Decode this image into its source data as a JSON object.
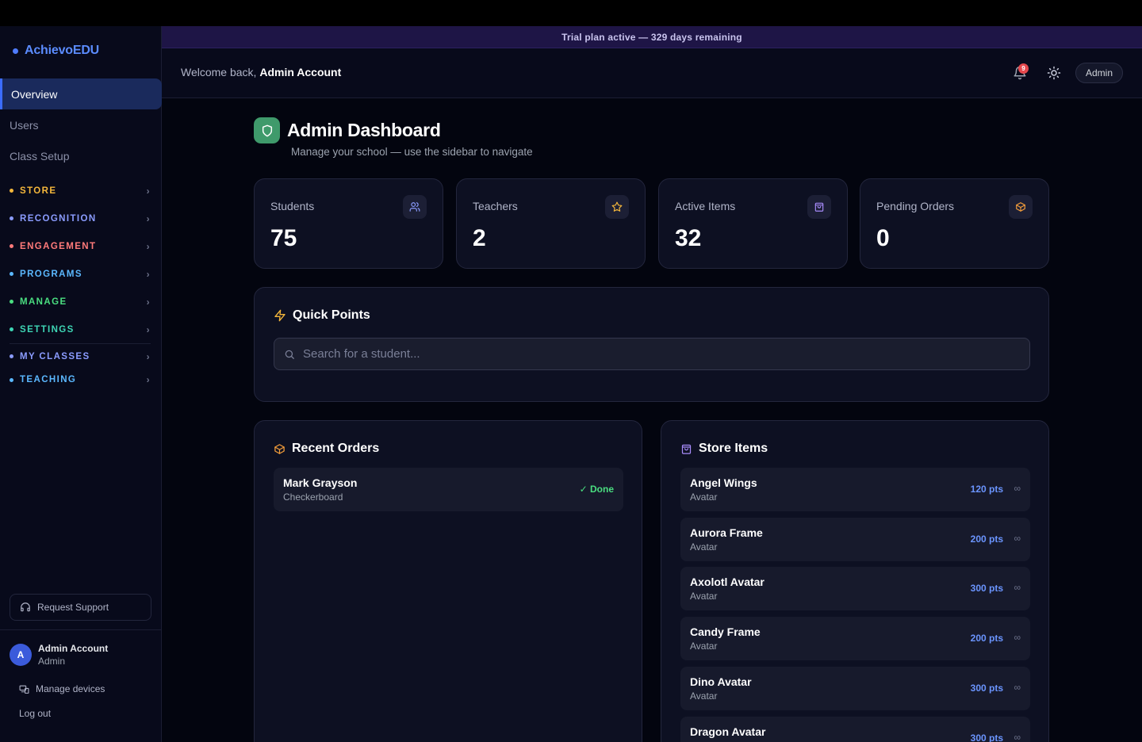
{
  "brand": {
    "name": "AchievoEDU"
  },
  "sidebar": {
    "main_items": [
      {
        "label": "Overview",
        "active": true
      },
      {
        "label": "Users",
        "active": false
      },
      {
        "label": "Class Setup",
        "active": false
      }
    ],
    "sections": [
      {
        "label": "STORE",
        "color": "#f5b73b"
      },
      {
        "label": "RECOGNITION",
        "color": "#8b9cff"
      },
      {
        "label": "ENGAGEMENT",
        "color": "#ff7a7a"
      },
      {
        "label": "PROGRAMS",
        "color": "#5bb8ff"
      },
      {
        "label": "MANAGE",
        "color": "#4ade80"
      },
      {
        "label": "SETTINGS",
        "color": "#3ed6b5"
      },
      {
        "label": "MY CLASSES",
        "color": "#8b9cff"
      },
      {
        "label": "TEACHING",
        "color": "#5bb8ff"
      }
    ],
    "support_label": "Request Support",
    "user": {
      "initial": "A",
      "name": "Admin Account",
      "role": "Admin"
    },
    "manage_devices": "Manage devices",
    "logout": "Log out"
  },
  "trial_banner": "Trial plan active — 329 days remaining",
  "header": {
    "welcome_prefix": "Welcome back,",
    "welcome_name": "Admin Account",
    "notification_count": "9",
    "role_pill": "Admin"
  },
  "page": {
    "title": "Admin Dashboard",
    "subtitle": "Manage your school — use the sidebar to navigate"
  },
  "stats": [
    {
      "label": "Students",
      "value": "75",
      "icon": "users-icon"
    },
    {
      "label": "Teachers",
      "value": "2",
      "icon": "star-icon"
    },
    {
      "label": "Active Items",
      "value": "32",
      "icon": "shopping-bag-icon"
    },
    {
      "label": "Pending Orders",
      "value": "0",
      "icon": "package-icon"
    }
  ],
  "quick_points": {
    "title": "Quick Points",
    "search_placeholder": "Search for a student..."
  },
  "recent_orders": {
    "title": "Recent Orders",
    "orders": [
      {
        "name": "Mark Grayson",
        "item": "Checkerboard",
        "status": "✓ Done"
      }
    ]
  },
  "store_items": {
    "title": "Store Items",
    "items": [
      {
        "name": "Angel Wings",
        "category": "Avatar",
        "price": "120 pts",
        "stock": "∞"
      },
      {
        "name": "Aurora Frame",
        "category": "Avatar",
        "price": "200 pts",
        "stock": "∞"
      },
      {
        "name": "Axolotl Avatar",
        "category": "Avatar",
        "price": "300 pts",
        "stock": "∞"
      },
      {
        "name": "Candy Frame",
        "category": "Avatar",
        "price": "200 pts",
        "stock": "∞"
      },
      {
        "name": "Dino Avatar",
        "category": "Avatar",
        "price": "300 pts",
        "stock": "∞"
      },
      {
        "name": "Dragon Avatar",
        "category": "",
        "price": "300 pts",
        "stock": "∞"
      }
    ]
  },
  "colors": {
    "accent": "#3b6cff",
    "success": "#4ade80",
    "title_icon_bg": "#3f9a6b"
  }
}
